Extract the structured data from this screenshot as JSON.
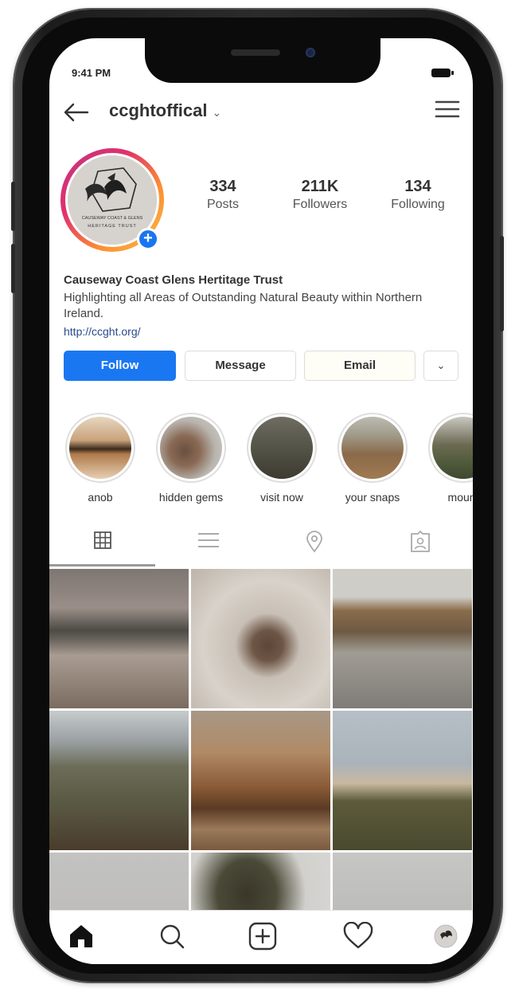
{
  "status": {
    "time": "9:41 PM"
  },
  "header": {
    "username": "ccghtoffical"
  },
  "profile": {
    "stats": [
      {
        "count": "334",
        "label": "Posts"
      },
      {
        "count": "211K",
        "label": "Followers"
      },
      {
        "count": "134",
        "label": "Following"
      }
    ],
    "name": "Causeway Coast Glens Hertitage Trust",
    "bio": "Highlighting all Areas of Outstanding Natural Beauty within Northern Ireland.",
    "link": "http://ccght.org/",
    "avatar_text_1": "CAUSEWAY COAST & GLENS",
    "avatar_text_2": "HERITAGE TRUST"
  },
  "actions": {
    "follow": "Follow",
    "message": "Message",
    "email": "Email",
    "more": "⌄"
  },
  "highlights": [
    {
      "label": "anob"
    },
    {
      "label": "hidden gems"
    },
    {
      "label": "visit now"
    },
    {
      "label": "your snaps"
    },
    {
      "label": "mount"
    }
  ],
  "tabs": [
    "grid-icon",
    "list-icon",
    "location-pin-icon",
    "tagged-icon"
  ],
  "bottom_nav": [
    "home-icon",
    "search-icon",
    "new-post-icon",
    "heart-icon",
    "profile-avatar-icon"
  ],
  "colors": {
    "primary_button": "#1a77f2",
    "story_ring_start": "#c13584",
    "story_ring_end": "#f5c042"
  }
}
